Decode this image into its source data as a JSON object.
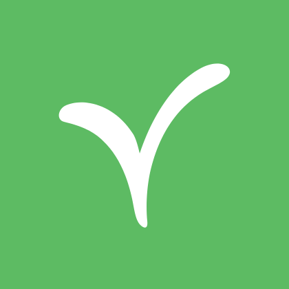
{
  "app": {
    "icon_name": "checkmark-sprout-icon",
    "colors": {
      "background": "#5dbb63",
      "mark": "#ffffff"
    }
  }
}
